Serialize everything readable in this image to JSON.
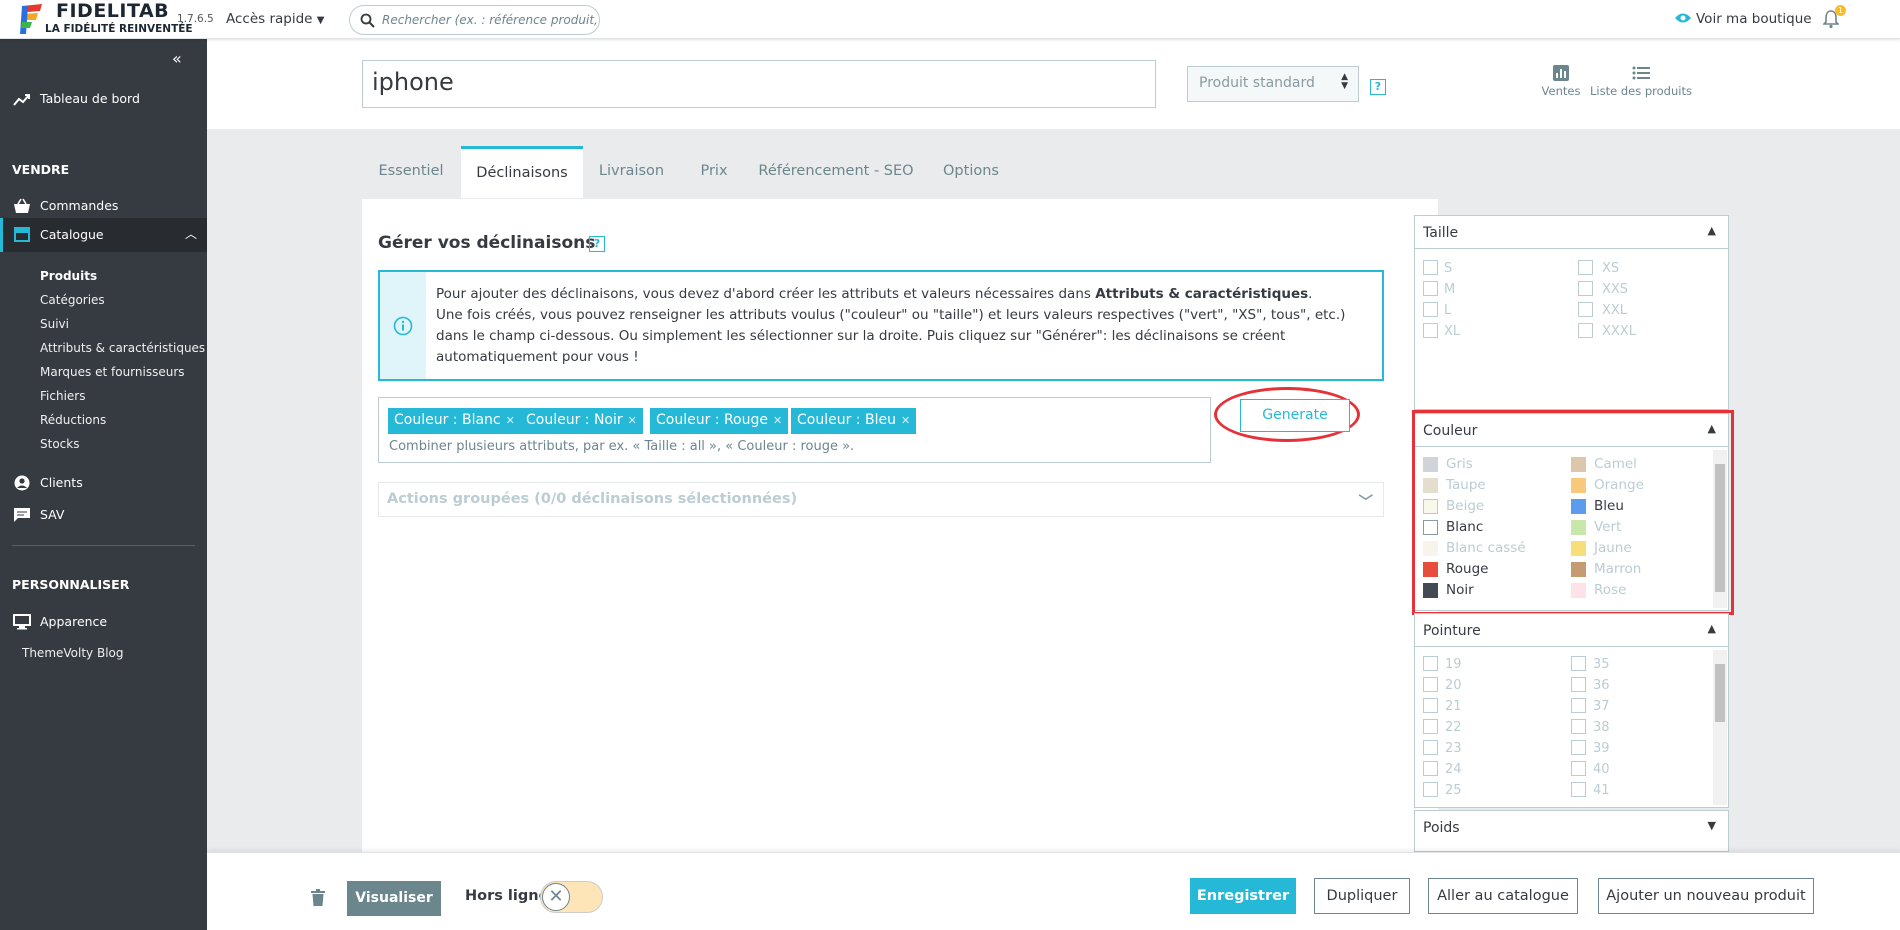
{
  "header": {
    "brand": "FIDELITAB",
    "tagline": "LA FIDÉLITÉ REINVENTÉE",
    "version": "1.7.6.5",
    "quick_access": "Accès rapide",
    "search_placeholder": "Rechercher (ex. : référence produit, nom",
    "view_shop": "Voir ma boutique",
    "notif_count": "1"
  },
  "sidebar": {
    "dashboard": "Tableau de bord",
    "section_sell": "VENDRE",
    "orders": "Commandes",
    "catalog": "Catalogue",
    "catalog_sub": [
      "Produits",
      "Catégories",
      "Suivi",
      "Attributs & caractéristiques",
      "Marques et fournisseurs",
      "Fichiers",
      "Réductions",
      "Stocks"
    ],
    "clients": "Clients",
    "sav": "SAV",
    "section_custom": "PERSONNALISER",
    "appearance": "Apparence",
    "blog": "ThemeVolty Blog"
  },
  "product": {
    "name": "iphone",
    "type": "Produit standard",
    "sales": "Ventes",
    "product_list": "Liste des produits"
  },
  "tabs": [
    "Essentiel",
    "Déclinaisons",
    "Livraison",
    "Prix",
    "Référencement - SEO",
    "Options"
  ],
  "combinations": {
    "title": "Gérer vos déclinaisons",
    "info_1": "Pour ajouter des déclinaisons, vous devez d'abord créer les attributs et valeurs nécessaires dans ",
    "info_bold": "Attributs & caractéristiques",
    "info_2": ".",
    "info_3": "Une fois créés, vous pouvez renseigner les attributs voulus (\"couleur\" ou \"taille\") et leurs valeurs respectives (\"vert\", \"XS\", tous\", etc.) dans le champ ci-dessous. Ou simplement les sélectionner sur la droite. Puis cliquez sur \"Générer\": les déclinaisons se créent automatiquement pour vous !",
    "tags": [
      "Couleur : Blanc",
      "Couleur : Noir",
      "Couleur : Rouge",
      "Couleur : Bleu"
    ],
    "tag_placeholder": "Combiner plusieurs attributs, par ex. « Taille : all », « Couleur : rouge ».",
    "generate": "Generate",
    "bulk_actions": "Actions groupées (0/0 déclinaisons sélectionnées)"
  },
  "attributes": {
    "size_title": "Taille",
    "sizes_left": [
      "S",
      "M",
      "L",
      "XL"
    ],
    "sizes_right": [
      "XS",
      "XXS",
      "XXL",
      "XXXL"
    ],
    "color_title": "Couleur",
    "colors_left": [
      {
        "name": "Gris",
        "color": "#aab2bd",
        "on": false
      },
      {
        "name": "Taupe",
        "color": "#cfc4a6",
        "on": false
      },
      {
        "name": "Beige",
        "color": "#f5f5dc",
        "on": false
      },
      {
        "name": "Blanc",
        "color": "#ffffff",
        "on": true
      },
      {
        "name": "Blanc cassé",
        "color": "#f4ecdf",
        "on": false
      },
      {
        "name": "Rouge",
        "color": "#e84c3d",
        "on": true
      },
      {
        "name": "Noir",
        "color": "#434a54",
        "on": true
      }
    ],
    "colors_right": [
      {
        "name": "Camel",
        "color": "#c19a6b",
        "on": false
      },
      {
        "name": "Orange",
        "color": "#f39c11",
        "on": false
      },
      {
        "name": "Bleu",
        "color": "#5d9cec",
        "on": true
      },
      {
        "name": "Vert",
        "color": "#a0d468",
        "on": false
      },
      {
        "name": "Jaune",
        "color": "#f1c40f",
        "on": false
      },
      {
        "name": "Marron",
        "color": "#964b00",
        "on": false
      },
      {
        "name": "Rose",
        "color": "#fcccd5",
        "on": false
      }
    ],
    "shoe_title": "Pointure",
    "shoes_left": [
      "19",
      "20",
      "21",
      "22",
      "23",
      "24",
      "25"
    ],
    "shoes_right": [
      "35",
      "36",
      "37",
      "38",
      "39",
      "40",
      "41"
    ],
    "weight_title": "Poids"
  },
  "footer": {
    "preview": "Visualiser",
    "offline": "Hors ligne",
    "save": "Enregistrer",
    "duplicate": "Dupliquer",
    "go_catalog": "Aller au catalogue",
    "add_new": "Ajouter un nouveau produit"
  }
}
